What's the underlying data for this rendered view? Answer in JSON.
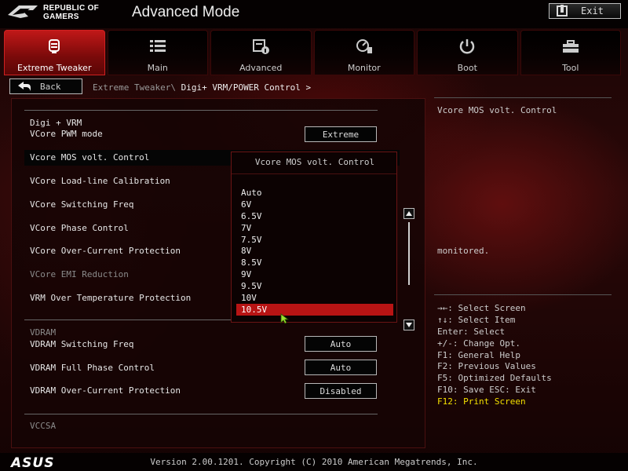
{
  "header": {
    "brand_line1": "REPUBLIC OF",
    "brand_line2": "GAMERS",
    "title": "Advanced Mode",
    "exit_label": "Exit"
  },
  "tabs": [
    {
      "label": "Extreme Tweaker",
      "icon": "tweaker-icon",
      "active": true
    },
    {
      "label": "Main",
      "icon": "list-icon",
      "active": false
    },
    {
      "label": "Advanced",
      "icon": "settings-doc-icon",
      "active": false
    },
    {
      "label": "Monitor",
      "icon": "gauge-icon",
      "active": false
    },
    {
      "label": "Boot",
      "icon": "power-icon",
      "active": false
    },
    {
      "label": "Tool",
      "icon": "toolbox-icon",
      "active": false
    }
  ],
  "nav": {
    "back_label": "Back",
    "breadcrumb_parent": "Extreme Tweaker\\",
    "breadcrumb_current": "Digi+ VRM/POWER Control >"
  },
  "settings": {
    "section_digi": "Digi + VRM",
    "items": [
      {
        "label": "VCore PWM mode",
        "value": "Extreme"
      },
      {
        "label": "Vcore MOS volt. Control"
      },
      {
        "label": "VCore Load-line Calibration"
      },
      {
        "label": "VCore Switching Freq"
      },
      {
        "label": "VCore Phase Control"
      },
      {
        "label": "VCore Over-Current Protection"
      },
      {
        "label": "VCore EMI Reduction"
      },
      {
        "label": "VRM Over Temperature Protection"
      }
    ],
    "section_vdram": "VDRAM",
    "vdram_items": [
      {
        "label": "VDRAM Switching Freq",
        "value": "Auto"
      },
      {
        "label": "VDRAM Full Phase Control",
        "value": "Auto"
      },
      {
        "label": "VDRAM Over-Current Protection",
        "value": "Disabled"
      }
    ],
    "section_vccsa": "VCCSA"
  },
  "dropdown": {
    "title": "Vcore MOS volt. Control",
    "options": [
      "Auto",
      "6V",
      "6.5V",
      "7V",
      "7.5V",
      "8V",
      "8.5V",
      "9V",
      "9.5V",
      "10V",
      "10.5V"
    ],
    "selected": "10.5V"
  },
  "help": {
    "description": "Vcore MOS volt. Control",
    "description_tail": "monitored.",
    "keys": [
      "→←: Select Screen",
      "↑↓: Select Item",
      "Enter: Select",
      "+/-: Change Opt.",
      "F1: General Help",
      "F2: Previous Values",
      "F5: Optimized Defaults",
      "F10: Save  ESC: Exit",
      "F12: Print Screen"
    ]
  },
  "footer": {
    "brand": "ASUS",
    "version": "Version 2.00.1201. Copyright (C) 2010 American Megatrends, Inc."
  },
  "colors": {
    "accent_red": "#c01818",
    "selected_red": "#b81414",
    "highlight_yellow": "#f4e000"
  }
}
